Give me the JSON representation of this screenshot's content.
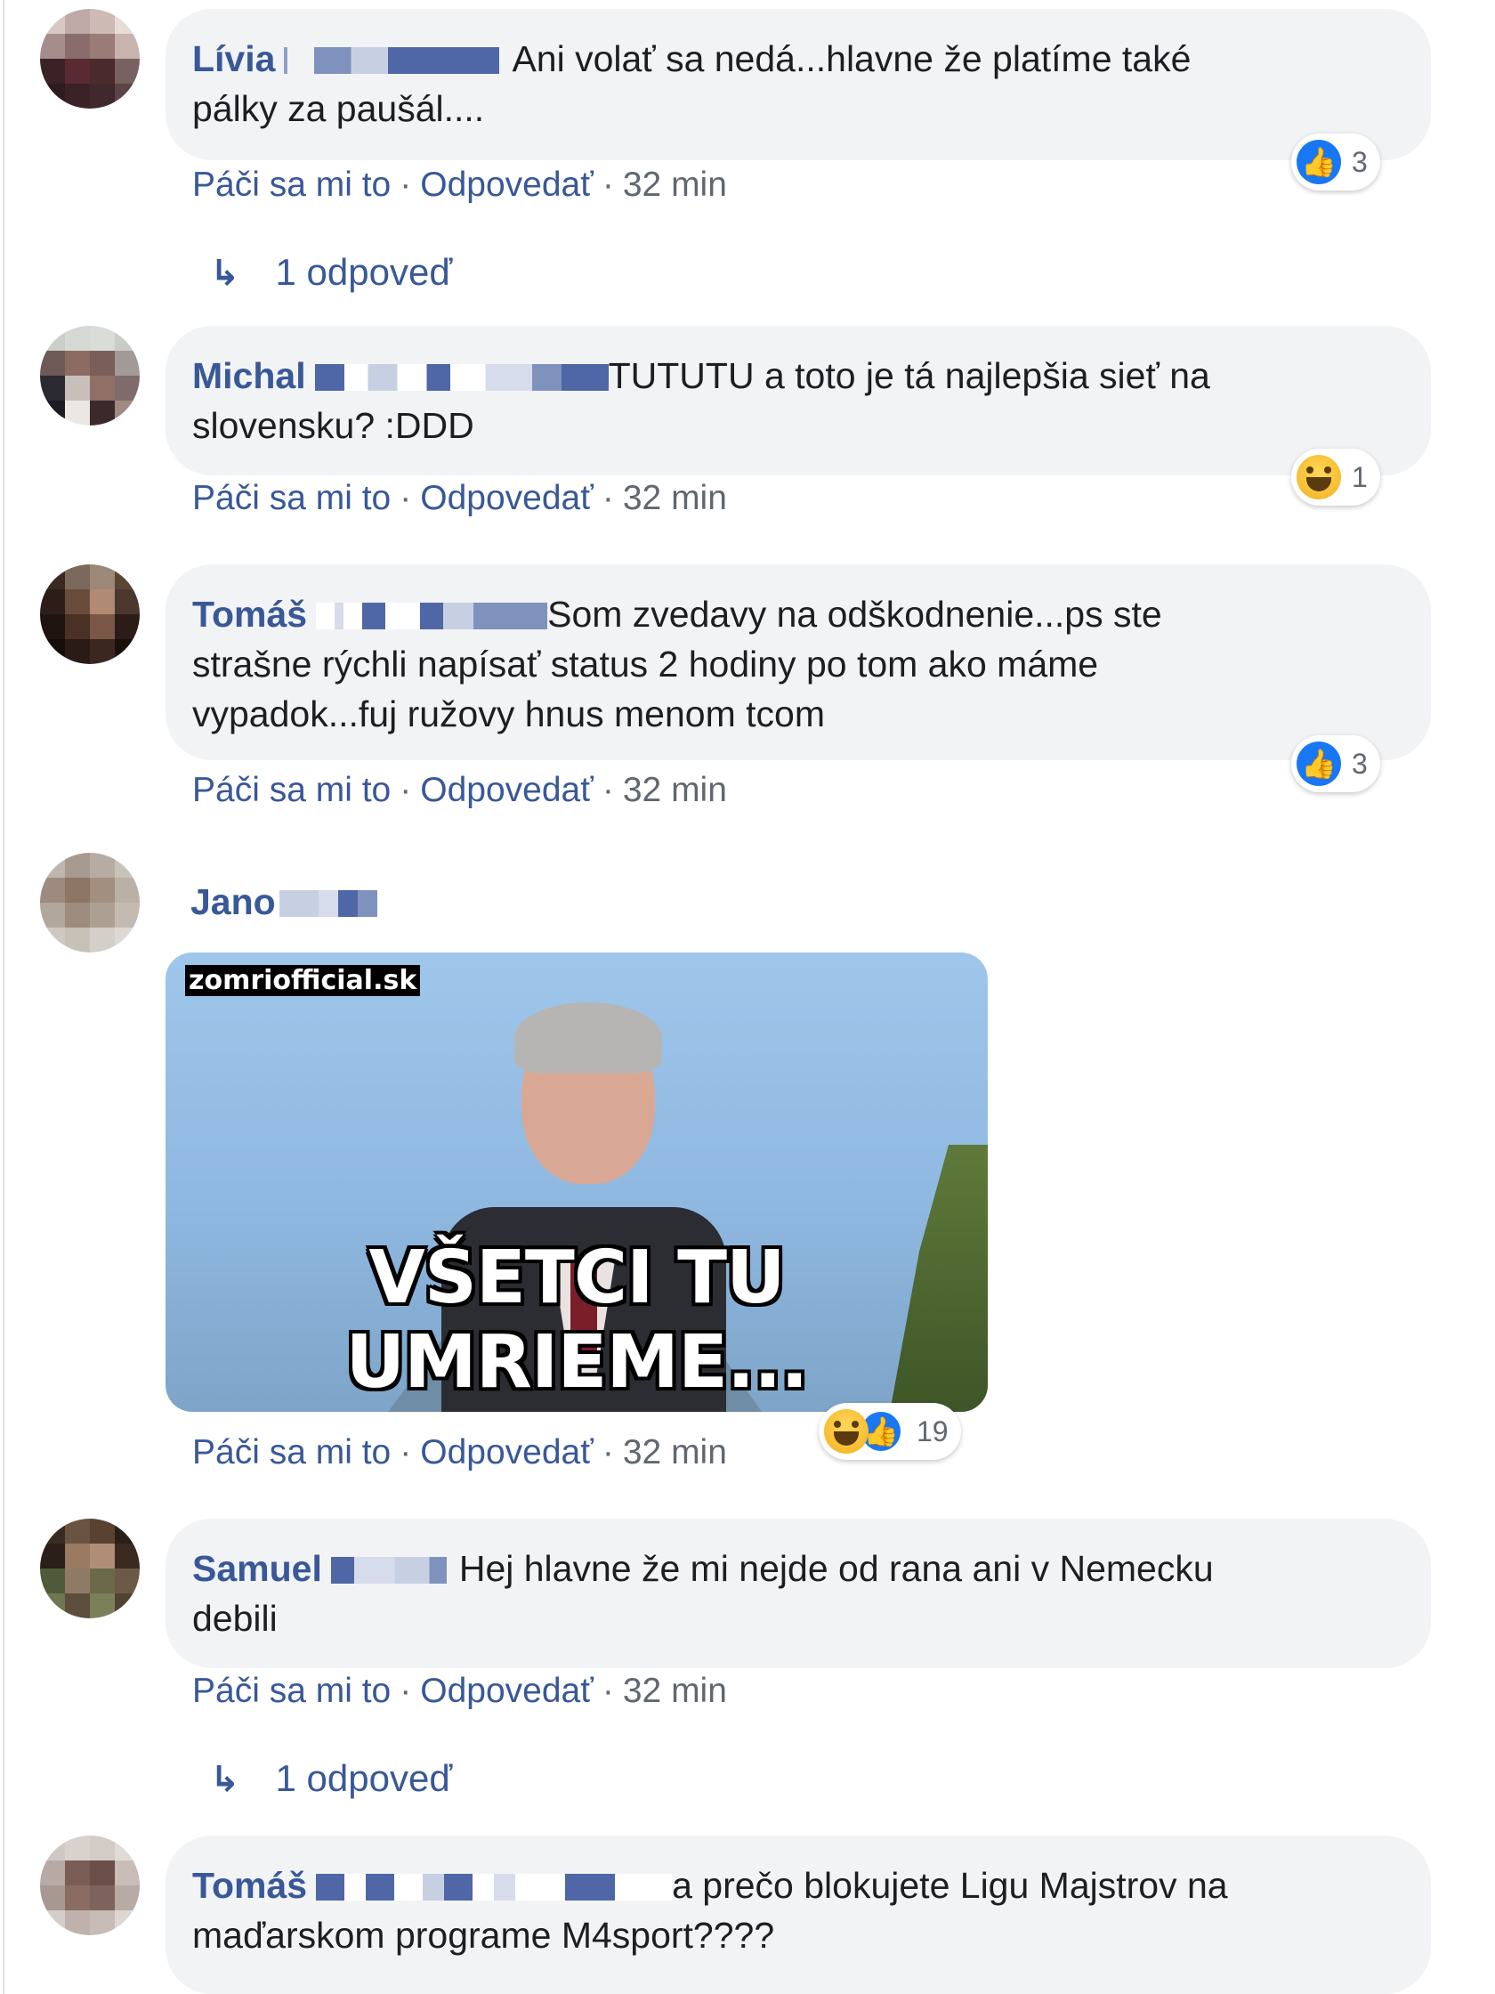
{
  "comments": [
    {
      "author": "Lívia",
      "text_line1": "Ani volať sa nedá...hlavne že platíme také",
      "text_line2": "pálky za paušál....",
      "like": "Páči sa mi to",
      "reply": "Odpovedať",
      "time": "32 min",
      "reaction_count": "3",
      "reaction_types": [
        "like"
      ],
      "reply_count": "1 odpoveď"
    },
    {
      "author": "Michal",
      "text_line1": "TUTUTU a toto je tá najlepšia sieť na",
      "text_line2": "slovensku? :DDD",
      "like": "Páči sa mi to",
      "reply": "Odpovedať",
      "time": "32 min",
      "reaction_count": "1",
      "reaction_types": [
        "haha"
      ]
    },
    {
      "author": "Tomáš",
      "text_line1": "Som zvedavy na odškodnenie...ps ste",
      "text_line2": "strašne rýchli napísať status 2 hodiny po tom ako máme",
      "text_line3": "vypadok...fuj ružovy hnus menom tcom",
      "like": "Páči sa mi to",
      "reply": "Odpovedať",
      "time": "32 min",
      "reaction_count": "3",
      "reaction_types": [
        "like"
      ]
    },
    {
      "author": "Jano",
      "meme_watermark": "zomriofficial.sk",
      "meme_caption": "VŠETCI TU UMRIEME...",
      "like": "Páči sa mi to",
      "reply": "Odpovedať",
      "time": "32 min",
      "reaction_count": "19",
      "reaction_types": [
        "haha",
        "like"
      ]
    },
    {
      "author": "Samuel",
      "text_line1": "Hej hlavne že mi nejde od rana ani v Nemecku",
      "text_line2": "debili",
      "like": "Páči sa mi to",
      "reply": "Odpovedať",
      "time": "32 min",
      "reply_count": "1 odpoveď"
    },
    {
      "author": "Tomáš",
      "text_line1": "a prečo blokujete Ligu Majstrov na",
      "text_line2": "maďarskom programe M4sport????"
    }
  ],
  "colors": {
    "name_link": "#385898",
    "bubble_bg": "#f2f3f5",
    "meta_gray": "#606770",
    "like_blue": "#1877f2"
  },
  "icons": {
    "reply_arrow": "↳",
    "like_icon": "👍"
  }
}
